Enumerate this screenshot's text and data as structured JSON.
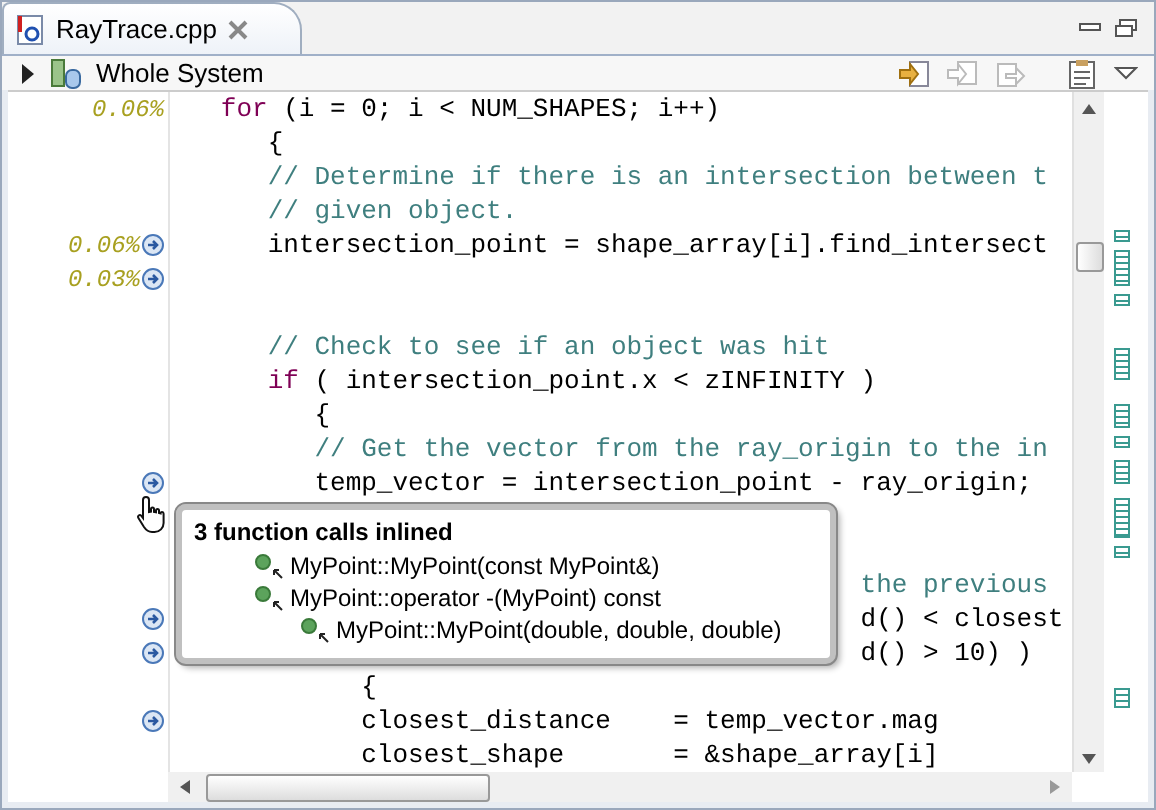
{
  "tab": {
    "label": "RayTrace.cpp"
  },
  "toolbar": {
    "label": "Whole System",
    "expanded": false
  },
  "code_lines": [
    {
      "percent": "0.06%",
      "marker": false,
      "parts": [
        {
          "kind": "keyword",
          "text": "   for"
        },
        {
          "kind": "plain",
          "text": " (i = 0; i < NUM_SHAPES; i++)"
        }
      ]
    },
    {
      "marker": false,
      "parts": [
        {
          "kind": "plain",
          "text": "      {"
        }
      ]
    },
    {
      "marker": false,
      "parts": [
        {
          "kind": "comment",
          "text": "      // Determine if there is an intersection between t"
        }
      ]
    },
    {
      "marker": false,
      "parts": [
        {
          "kind": "comment",
          "text": "      // given object."
        }
      ]
    },
    {
      "percent": "0.06%",
      "marker": true,
      "parts": [
        {
          "kind": "plain",
          "text": "      intersection_point = shape_array[i].find_intersect"
        }
      ]
    },
    {
      "percent": "0.03%",
      "marker": true
    },
    {
      "marker": false
    },
    {
      "marker": false,
      "parts": [
        {
          "kind": "comment",
          "text": "      // Check to see if an object was hit"
        }
      ]
    },
    {
      "marker": false,
      "parts": [
        {
          "kind": "keyword",
          "text": "      if"
        },
        {
          "kind": "plain",
          "text": " ( intersection_point.x < zINFINITY )"
        }
      ]
    },
    {
      "marker": false,
      "parts": [
        {
          "kind": "plain",
          "text": "         {"
        }
      ]
    },
    {
      "marker": false,
      "parts": [
        {
          "kind": "comment",
          "text": "         // Get the vector from the ray_origin to the in"
        }
      ]
    },
    {
      "marker": true,
      "parts": [
        {
          "kind": "plain",
          "text": "         temp_vector = intersection_point - ray_origin;"
        }
      ]
    },
    {
      "marker": false
    },
    {
      "marker": false
    },
    {
      "marker": false,
      "parts": [
        {
          "kind": "comment",
          "text": "                                            the previous"
        }
      ]
    },
    {
      "marker": true,
      "parts": [
        {
          "kind": "plain",
          "text": "                                            d() < closest"
        }
      ]
    },
    {
      "marker": true,
      "parts": [
        {
          "kind": "plain",
          "text": "                                            d() > 10) )"
        }
      ]
    },
    {
      "marker": false,
      "parts": [
        {
          "kind": "plain",
          "text": "            {"
        }
      ]
    },
    {
      "marker": true,
      "parts": [
        {
          "kind": "plain",
          "text": "            closest_distance    = temp_vector.mag"
        }
      ]
    },
    {
      "marker": false,
      "parts": [
        {
          "kind": "plain",
          "text": "            closest_shape       = &shape_array[i]"
        }
      ]
    }
  ],
  "popup": {
    "title": "3 function calls inlined",
    "items": [
      {
        "label": "MyPoint::MyPoint(const MyPoint&)"
      },
      {
        "label": "MyPoint::operator -(MyPoint) const",
        "children": [
          {
            "label": "MyPoint::MyPoint(double, double, double)"
          }
        ]
      }
    ]
  }
}
